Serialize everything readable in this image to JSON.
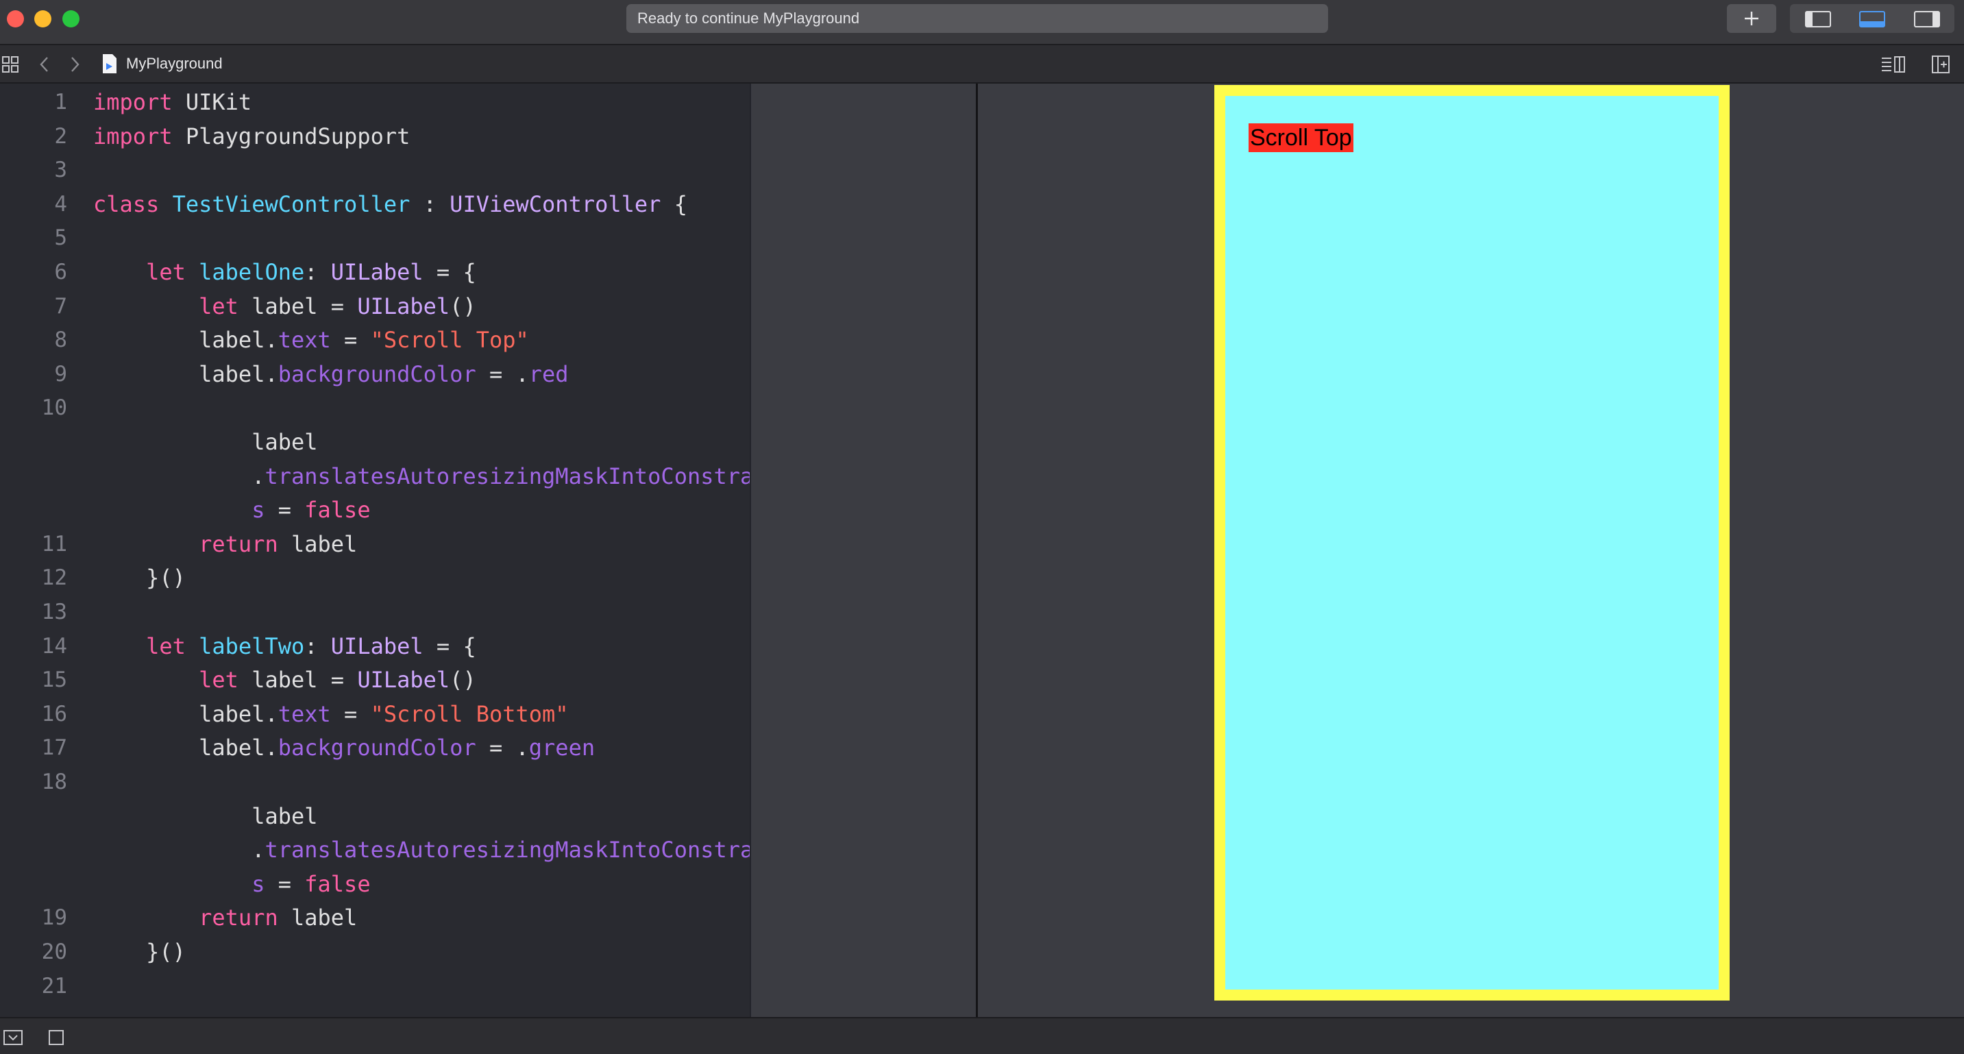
{
  "window": {
    "activity_text": "Ready to continue MyPlayground"
  },
  "jumpbar": {
    "file_name": "MyPlayground"
  },
  "editor": {
    "lines": [
      {
        "n": "1",
        "tokens": [
          [
            "k",
            "import"
          ],
          [
            "",
            " UIKit"
          ]
        ]
      },
      {
        "n": "2",
        "tokens": [
          [
            "k",
            "import"
          ],
          [
            "",
            " PlaygroundSupport"
          ]
        ]
      },
      {
        "n": "3",
        "tokens": []
      },
      {
        "n": "4",
        "tokens": [
          [
            "k",
            "class"
          ],
          [
            "",
            " "
          ],
          [
            "t",
            "TestViewController"
          ],
          [
            "",
            " : "
          ],
          [
            "c",
            "UIViewController"
          ],
          [
            "",
            " {"
          ]
        ]
      },
      {
        "n": "5",
        "tokens": []
      },
      {
        "n": "6",
        "tokens": [
          [
            "",
            "    "
          ],
          [
            "k",
            "let"
          ],
          [
            "",
            " "
          ],
          [
            "t",
            "labelOne"
          ],
          [
            "",
            ": "
          ],
          [
            "c",
            "UILabel"
          ],
          [
            "",
            " = {"
          ]
        ]
      },
      {
        "n": "7",
        "tokens": [
          [
            "",
            "        "
          ],
          [
            "k",
            "let"
          ],
          [
            "",
            " label = "
          ],
          [
            "c",
            "UILabel"
          ],
          [
            "",
            "()"
          ]
        ]
      },
      {
        "n": "8",
        "tokens": [
          [
            "",
            "        label."
          ],
          [
            "p",
            "text"
          ],
          [
            "",
            " = "
          ],
          [
            "s",
            "\"Scroll Top\""
          ]
        ]
      },
      {
        "n": "9",
        "tokens": [
          [
            "",
            "        label."
          ],
          [
            "p",
            "backgroundColor"
          ],
          [
            "",
            " = ."
          ],
          [
            "p",
            "red"
          ]
        ]
      },
      {
        "n": "10",
        "tokens": []
      },
      {
        "n": "",
        "tokens": [
          [
            "",
            "            label"
          ]
        ]
      },
      {
        "n": "",
        "tokens": [
          [
            "",
            "            ."
          ],
          [
            "p",
            "translatesAutoresizingMaskIntoConstraint"
          ]
        ]
      },
      {
        "n": "",
        "tokens": [
          [
            "",
            "            "
          ],
          [
            "p",
            "s"
          ],
          [
            "",
            " = "
          ],
          [
            "k",
            "false"
          ]
        ]
      },
      {
        "n": "11",
        "tokens": [
          [
            "",
            "        "
          ],
          [
            "k",
            "return"
          ],
          [
            "",
            " label"
          ]
        ]
      },
      {
        "n": "12",
        "tokens": [
          [
            "",
            "    }()"
          ]
        ]
      },
      {
        "n": "13",
        "tokens": []
      },
      {
        "n": "14",
        "tokens": [
          [
            "",
            "    "
          ],
          [
            "k",
            "let"
          ],
          [
            "",
            " "
          ],
          [
            "t",
            "labelTwo"
          ],
          [
            "",
            ": "
          ],
          [
            "c",
            "UILabel"
          ],
          [
            "",
            " = {"
          ]
        ]
      },
      {
        "n": "15",
        "tokens": [
          [
            "",
            "        "
          ],
          [
            "k",
            "let"
          ],
          [
            "",
            " label = "
          ],
          [
            "c",
            "UILabel"
          ],
          [
            "",
            "()"
          ]
        ]
      },
      {
        "n": "16",
        "tokens": [
          [
            "",
            "        label."
          ],
          [
            "p",
            "text"
          ],
          [
            "",
            " = "
          ],
          [
            "s",
            "\"Scroll Bottom\""
          ]
        ]
      },
      {
        "n": "17",
        "tokens": [
          [
            "",
            "        label."
          ],
          [
            "p",
            "backgroundColor"
          ],
          [
            "",
            " = ."
          ],
          [
            "p",
            "green"
          ]
        ]
      },
      {
        "n": "18",
        "tokens": []
      },
      {
        "n": "",
        "tokens": [
          [
            "",
            "            label"
          ]
        ]
      },
      {
        "n": "",
        "tokens": [
          [
            "",
            "            ."
          ],
          [
            "p",
            "translatesAutoresizingMaskIntoConstraint"
          ]
        ]
      },
      {
        "n": "",
        "tokens": [
          [
            "",
            "            "
          ],
          [
            "p",
            "s"
          ],
          [
            "",
            " = "
          ],
          [
            "k",
            "false"
          ]
        ]
      },
      {
        "n": "19",
        "tokens": [
          [
            "",
            "        "
          ],
          [
            "k",
            "return"
          ],
          [
            "",
            " label"
          ]
        ]
      },
      {
        "n": "20",
        "tokens": [
          [
            "",
            "    }()"
          ]
        ]
      },
      {
        "n": "21",
        "tokens": []
      }
    ]
  },
  "live_view": {
    "label_text": "Scroll Top",
    "label_color": "#fc2b20",
    "content_background": "#8afcfd",
    "border_color": "#fefc4b"
  },
  "icons": {
    "new_file": "plus-icon",
    "hide_navigator": "left-panel-icon",
    "hide_debug": "bottom-panel-icon",
    "hide_inspector": "right-panel-icon",
    "grid": "related-items-grid-icon",
    "back": "chevron-left-icon",
    "forward": "chevron-right-icon",
    "playground_file": "playground-file-icon",
    "adjust_editor": "editor-options-icon",
    "add_editor": "add-editor-icon",
    "debug_toggle": "debug-area-toggle-icon",
    "execute": "execute-stop-icon"
  }
}
